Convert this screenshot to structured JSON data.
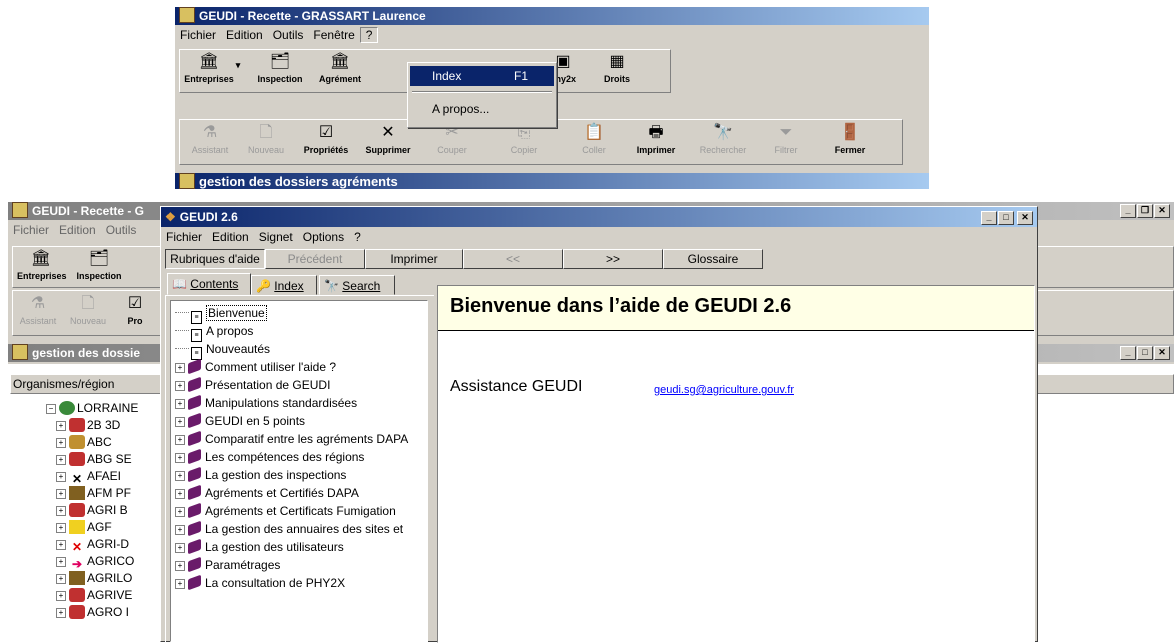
{
  "top_window": {
    "title": "GEUDI - Recette - GRASSART Laurence",
    "menu": [
      "Fichier",
      "Edition",
      "Outils",
      "Fenêtre",
      "?"
    ],
    "toolbar1": [
      {
        "label": "Entreprises",
        "icon": "bank-icon"
      },
      {
        "label": "Inspection",
        "icon": "inspection-icon"
      },
      {
        "label": "Agrément",
        "icon": "agrement-icon"
      },
      {
        "label": "phy2x",
        "icon": "phy2x-icon"
      },
      {
        "label": "Droits",
        "icon": "rights-icon"
      }
    ],
    "toolbar2": [
      {
        "label": "Assistant",
        "icon": "wizard-icon",
        "enabled": false
      },
      {
        "label": "Nouveau",
        "icon": "new-document-icon",
        "enabled": false
      },
      {
        "label": "Propriétés",
        "icon": "properties-icon",
        "enabled": true
      },
      {
        "label": "Supprimer",
        "icon": "delete-icon",
        "enabled": true
      },
      {
        "label": "Couper",
        "icon": "cut-icon",
        "enabled": false
      },
      {
        "label": "Copier",
        "icon": "copy-icon",
        "enabled": false
      },
      {
        "label": "Coller",
        "icon": "paste-icon",
        "enabled": false
      },
      {
        "label": "Imprimer",
        "icon": "printer-icon",
        "enabled": true
      },
      {
        "label": "Rechercher",
        "icon": "search-icon",
        "enabled": false
      },
      {
        "label": "Filtrer",
        "icon": "filter-icon",
        "enabled": false
      },
      {
        "label": "Fermer",
        "icon": "close-door-icon",
        "enabled": true
      }
    ],
    "dropdown": {
      "items": [
        {
          "label": "Index",
          "shortcut": "F1"
        },
        {
          "label": "A propos...",
          "shortcut": ""
        }
      ]
    },
    "child_title": "gestion des dossiers agréments"
  },
  "background_window": {
    "title": "GEUDI - Recette - G",
    "menu": [
      "Fichier",
      "Edition",
      "Outils"
    ],
    "toolbar1": [
      {
        "label": "Entreprises"
      },
      {
        "label": "Inspection"
      }
    ],
    "toolbar2": [
      {
        "label": "Assistant"
      },
      {
        "label": "Nouveau"
      },
      {
        "label": "Pro"
      }
    ],
    "child_title": "gestion des dossie",
    "column_header": "Organismes/région",
    "tree": [
      {
        "label": "LORRAINE",
        "level": 0
      },
      {
        "label": "2B 3D",
        "level": 1
      },
      {
        "label": "ABC",
        "level": 1
      },
      {
        "label": "ABG SE",
        "level": 1
      },
      {
        "label": "AFAEI",
        "level": 1
      },
      {
        "label": "AFM PF",
        "level": 1
      },
      {
        "label": "AGRI B",
        "level": 1
      },
      {
        "label": "AGF",
        "level": 1
      },
      {
        "label": "AGRI-D",
        "level": 1
      },
      {
        "label": "AGRICO",
        "level": 1
      },
      {
        "label": "AGRILO",
        "level": 1
      },
      {
        "label": "AGRIVE",
        "level": 1
      },
      {
        "label": "AGRO I",
        "level": 1
      }
    ]
  },
  "help_window": {
    "title": "GEUDI 2.6",
    "menu": [
      "Fichier",
      "Edition",
      "Signet",
      "Options",
      "?"
    ],
    "nav_buttons": [
      "Rubriques d'aide",
      "Précédent",
      "Imprimer",
      "<<",
      ">>",
      "Glossaire"
    ],
    "tabs": [
      "Contents",
      "Index",
      "Search"
    ],
    "contents": [
      {
        "label": "Bienvenue",
        "type": "page",
        "selected": true
      },
      {
        "label": "A propos",
        "type": "page"
      },
      {
        "label": "Nouveautés",
        "type": "page"
      },
      {
        "label": "Comment utiliser l'aide ?",
        "type": "book"
      },
      {
        "label": "Présentation de GEUDI",
        "type": "book"
      },
      {
        "label": "Manipulations standardisées",
        "type": "book"
      },
      {
        "label": "GEUDI en 5 points",
        "type": "book"
      },
      {
        "label": "Comparatif entre les agréments DAPA",
        "type": "book"
      },
      {
        "label": "Les compétences des régions",
        "type": "book"
      },
      {
        "label": "La gestion des inspections",
        "type": "book"
      },
      {
        "label": "Agréments et Certifiés DAPA",
        "type": "book"
      },
      {
        "label": "Agréments et Certificats Fumigation",
        "type": "book"
      },
      {
        "label": "La gestion des annuaires des sites et",
        "type": "book"
      },
      {
        "label": "La gestion des utilisateurs",
        "type": "book"
      },
      {
        "label": "Paramétrages",
        "type": "book"
      },
      {
        "label": "La consultation de PHY2X",
        "type": "book"
      }
    ],
    "topic_heading": "Bienvenue dans l’aide de GEUDI 2.6",
    "assistance_label": "Assistance GEUDI",
    "assistance_email": "geudi.sg@agriculture.gouv.fr"
  },
  "colors": {
    "title_active": "#0a246a",
    "title_gradient_end": "#a6caf0",
    "face": "#d4d0c8",
    "heading_bg": "#ffffe6",
    "link": "#0000ff",
    "book": "#6a1b6a"
  }
}
